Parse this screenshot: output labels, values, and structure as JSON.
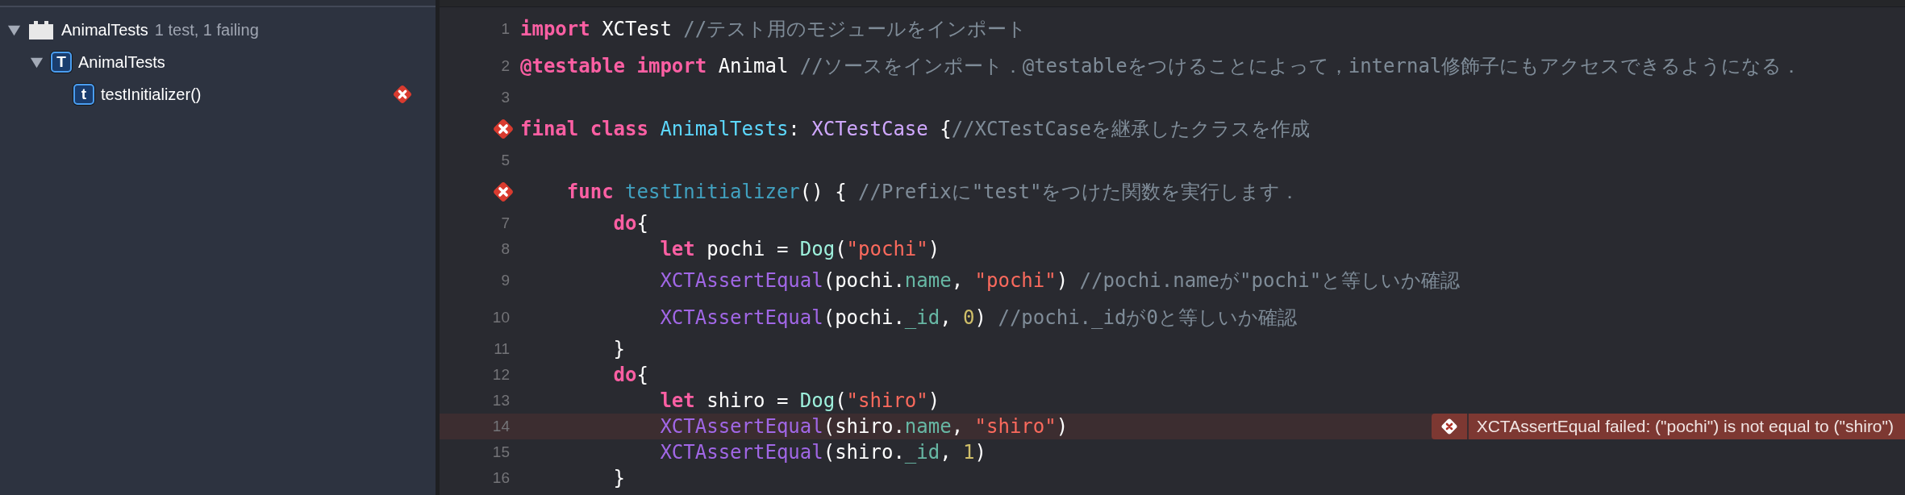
{
  "sidebar": {
    "tree": [
      {
        "kind": "bundle",
        "label": "AnimalTests",
        "detail": "1 test, 1 failing",
        "expanded": true,
        "children": [
          {
            "kind": "class",
            "badge": "T",
            "label": "AnimalTests",
            "expanded": true,
            "children": [
              {
                "kind": "test",
                "badge": "t",
                "label": "testInitializer()",
                "failed": true
              }
            ]
          }
        ]
      }
    ]
  },
  "editor": {
    "lines": [
      {
        "number": "1",
        "error": false,
        "highlighted": false,
        "tokens": [
          {
            "kind": "kw",
            "text": "import"
          },
          {
            "kind": "plain",
            "text": " XCTest "
          },
          {
            "kind": "comment",
            "text": "//テスト用のモジュールをインポート"
          }
        ]
      },
      {
        "number": "2",
        "error": false,
        "highlighted": false,
        "tokens": [
          {
            "kind": "kw",
            "text": "@testable import"
          },
          {
            "kind": "plain",
            "text": " Animal "
          },
          {
            "kind": "comment",
            "text": "//ソースをインポート．@testableをつけることによって，internal修飾子にもアクセスできるようになる．"
          }
        ]
      },
      {
        "number": "3",
        "error": false,
        "highlighted": false
      },
      {
        "error": true,
        "highlighted": false,
        "tokens": [
          {
            "kind": "kw",
            "text": "final class "
          },
          {
            "kind": "typedecl",
            "text": "AnimalTests"
          },
          {
            "kind": "plain",
            "text": ": "
          },
          {
            "kind": "type",
            "text": "XCTestCase"
          },
          {
            "kind": "plain",
            "text": " {"
          },
          {
            "kind": "comment",
            "text": "//XCTestCaseを継承したクラスを作成"
          }
        ]
      },
      {
        "number": "5",
        "error": false,
        "highlighted": false
      },
      {
        "error": true,
        "highlighted": false,
        "tokens": [
          {
            "kind": "kw",
            "text": "    func "
          },
          {
            "kind": "funcdecl",
            "text": "testInitializer"
          },
          {
            "kind": "plain",
            "text": "() { "
          },
          {
            "kind": "comment",
            "text": "//Prefixに\"test\"をつけた関数を実行します．"
          }
        ]
      },
      {
        "number": "7",
        "error": false,
        "highlighted": false,
        "tokens": [
          {
            "kind": "kw",
            "text": "        do"
          },
          {
            "kind": "plain",
            "text": "{"
          }
        ]
      },
      {
        "number": "8",
        "error": false,
        "highlighted": false,
        "tokens": [
          {
            "kind": "kw",
            "text": "            let"
          },
          {
            "kind": "plain",
            "text": " pochi = "
          },
          {
            "kind": "classref",
            "text": "Dog"
          },
          {
            "kind": "plain",
            "text": "("
          },
          {
            "kind": "str",
            "text": "\"pochi\""
          },
          {
            "kind": "plain",
            "text": ")"
          }
        ]
      },
      {
        "number": "9",
        "error": false,
        "highlighted": false,
        "tokens": [
          {
            "kind": "call",
            "text": "            XCTAssertEqual"
          },
          {
            "kind": "plain",
            "text": "(pochi."
          },
          {
            "kind": "prop",
            "text": "name"
          },
          {
            "kind": "plain",
            "text": ", "
          },
          {
            "kind": "str",
            "text": "\"pochi\""
          },
          {
            "kind": "plain",
            "text": ") "
          },
          {
            "kind": "comment",
            "text": "//pochi.nameが\"pochi\"と等しいか確認"
          }
        ]
      },
      {
        "number": "10",
        "error": false,
        "highlighted": false,
        "tokens": [
          {
            "kind": "call",
            "text": "            XCTAssertEqual"
          },
          {
            "kind": "plain",
            "text": "(pochi."
          },
          {
            "kind": "prop",
            "text": "_id"
          },
          {
            "kind": "plain",
            "text": ", "
          },
          {
            "kind": "num",
            "text": "0"
          },
          {
            "kind": "plain",
            "text": ") "
          },
          {
            "kind": "comment",
            "text": "//pochi._idが0と等しいか確認"
          }
        ]
      },
      {
        "number": "11",
        "error": false,
        "highlighted": false,
        "tokens": [
          {
            "kind": "plain",
            "text": "        }"
          }
        ]
      },
      {
        "number": "12",
        "error": false,
        "highlighted": false,
        "tokens": [
          {
            "kind": "kw",
            "text": "        do"
          },
          {
            "kind": "plain",
            "text": "{"
          }
        ]
      },
      {
        "number": "13",
        "error": false,
        "highlighted": false,
        "tokens": [
          {
            "kind": "kw",
            "text": "            let"
          },
          {
            "kind": "plain",
            "text": " shiro = "
          },
          {
            "kind": "classref",
            "text": "Dog"
          },
          {
            "kind": "plain",
            "text": "("
          },
          {
            "kind": "str",
            "text": "\"shiro\""
          },
          {
            "kind": "plain",
            "text": ")"
          }
        ]
      },
      {
        "number": "14",
        "error": false,
        "highlighted": true,
        "issue": "XCTAssertEqual failed: (\"pochi\") is not equal to (\"shiro\")",
        "tokens": [
          {
            "kind": "call",
            "text": "            XCTAssertEqual"
          },
          {
            "kind": "plain",
            "text": "(shiro."
          },
          {
            "kind": "prop",
            "text": "name"
          },
          {
            "kind": "plain",
            "text": ", "
          },
          {
            "kind": "str",
            "text": "\"shiro\""
          },
          {
            "kind": "plain",
            "text": ")"
          }
        ]
      },
      {
        "number": "15",
        "error": false,
        "highlighted": false,
        "tokens": [
          {
            "kind": "call",
            "text": "            XCTAssertEqual"
          },
          {
            "kind": "plain",
            "text": "(shiro."
          },
          {
            "kind": "prop",
            "text": "_id"
          },
          {
            "kind": "plain",
            "text": ", "
          },
          {
            "kind": "num",
            "text": "1"
          },
          {
            "kind": "plain",
            "text": ")"
          }
        ]
      },
      {
        "number": "16",
        "error": false,
        "highlighted": false,
        "tokens": [
          {
            "kind": "plain",
            "text": "        }"
          }
        ]
      }
    ]
  }
}
